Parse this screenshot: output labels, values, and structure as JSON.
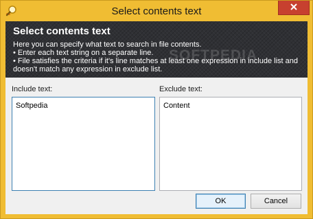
{
  "window": {
    "title": "Select contents text",
    "close_icon": "close-icon",
    "app_icon": "magnifier-icon"
  },
  "banner": {
    "title": "Select contents text",
    "lines": [
      "Here you can specify what text to search in file contents.",
      "• Enter each text string on a separate line.",
      "• File satisfies the criteria if it's line matches at least one expression in include list and",
      "doesn't match any expression in exclude list."
    ],
    "watermark": "SOFTPEDIA"
  },
  "include": {
    "label": "Include text:",
    "value": "Softpedia"
  },
  "exclude": {
    "label": "Exclude text:",
    "value": "Content"
  },
  "buttons": {
    "ok": "OK",
    "cancel": "Cancel"
  },
  "colors": {
    "frame": "#f0bd33",
    "close_button": "#c7402f",
    "banner_background": "#2f3034",
    "focus_border": "#3c7fb1"
  }
}
